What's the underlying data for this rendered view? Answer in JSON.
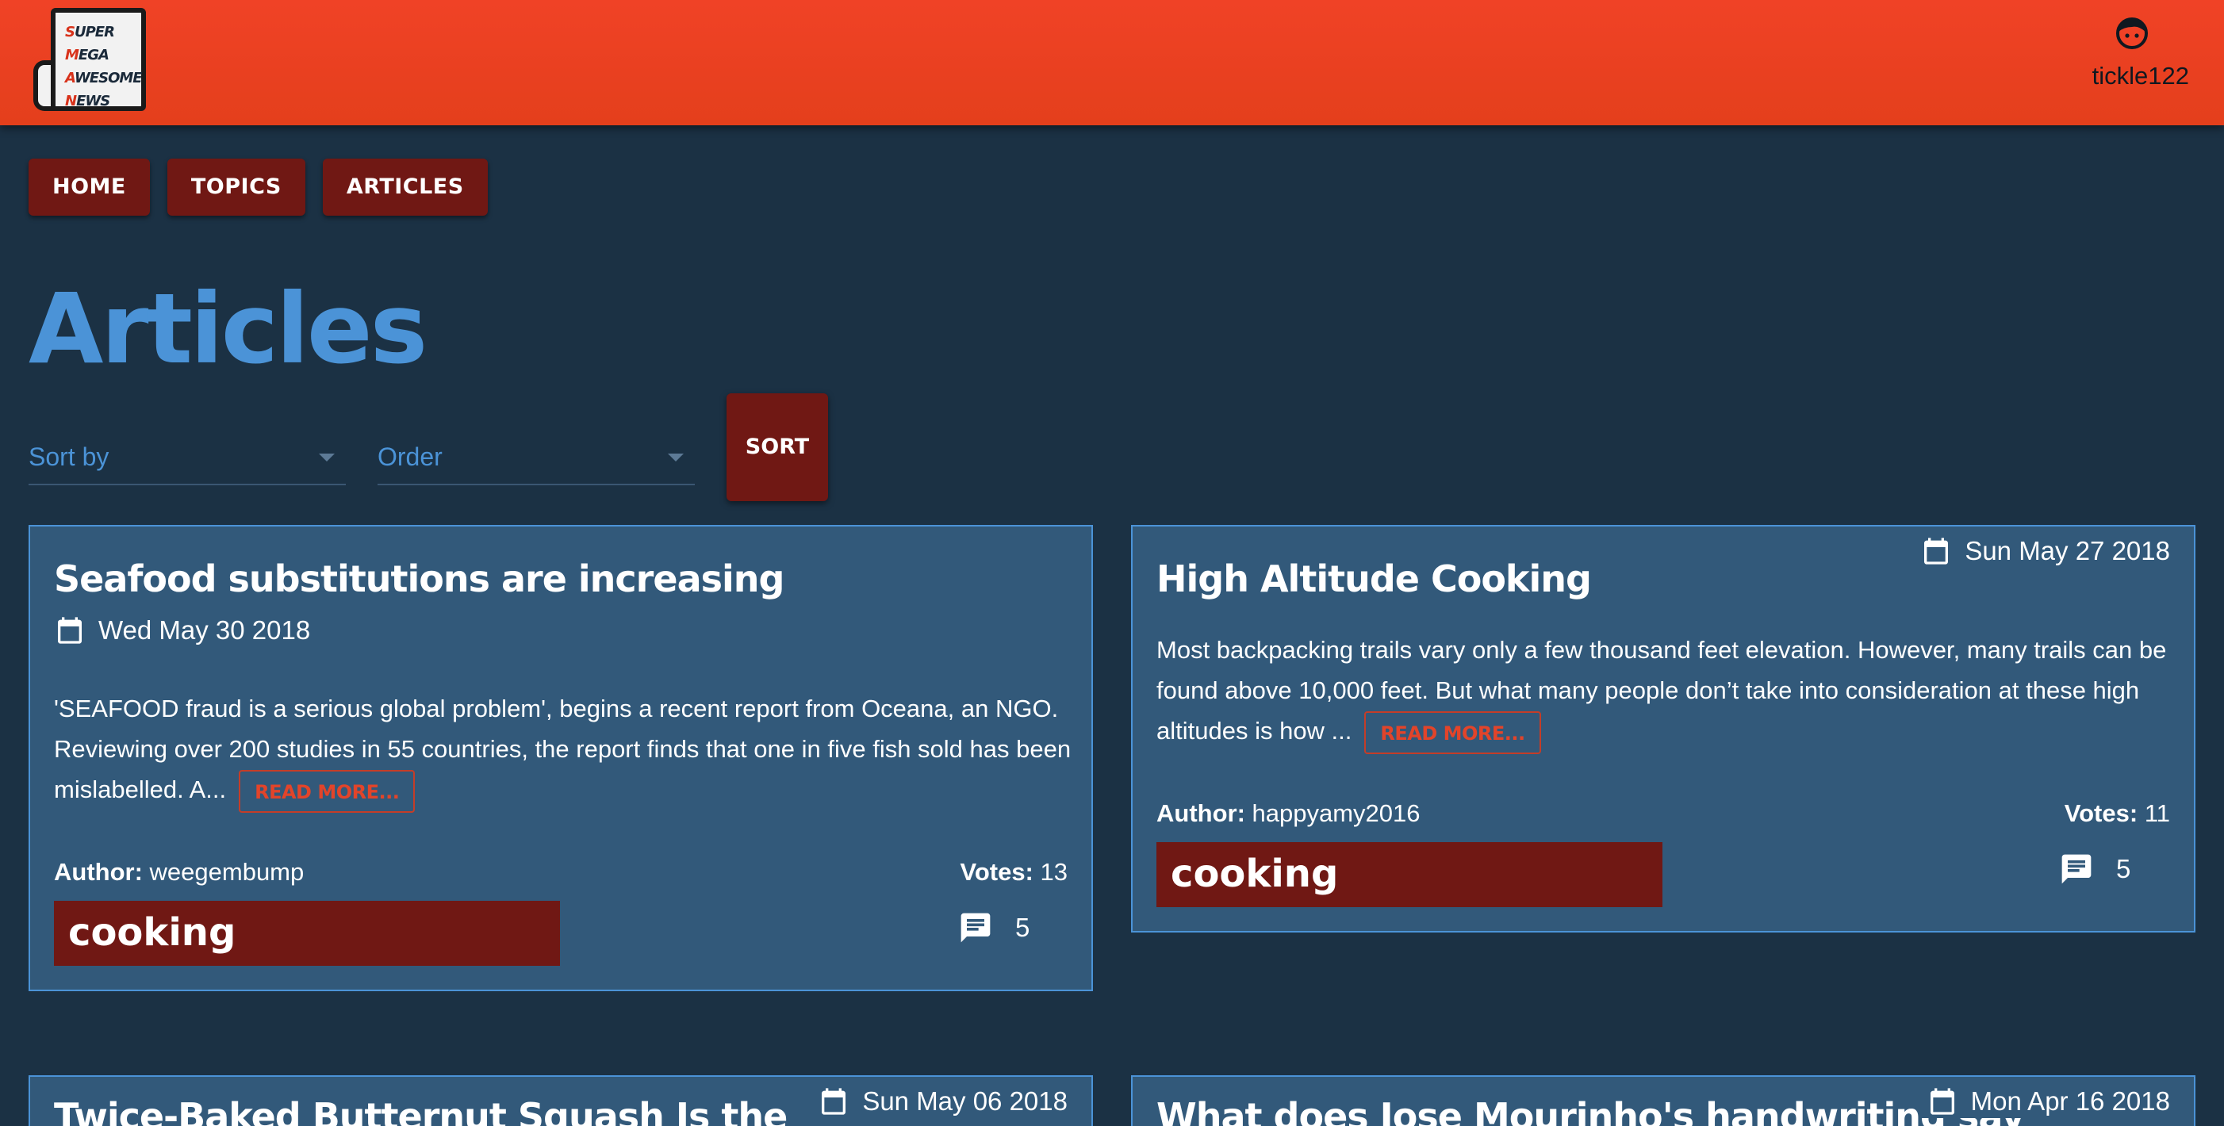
{
  "header": {
    "logo_lines": [
      "SUPER",
      "MEGA",
      "AWESOME",
      "NEWS"
    ],
    "username": "tickle122"
  },
  "nav": {
    "home": "HOME",
    "topics": "TOPICS",
    "articles": "ARTICLES"
  },
  "page_title": "Articles",
  "controls": {
    "sort_by_label": "Sort by",
    "order_label": "Order",
    "sort_button": "SORT"
  },
  "labels": {
    "author": "Author:",
    "votes": "Votes:",
    "read_more": "READ MORE..."
  },
  "articles": [
    {
      "title": "Seafood substitutions are increasing",
      "date": "Wed May 30 2018",
      "excerpt": "'SEAFOOD fraud is a serious global problem', begins a recent report from Oceana, an NGO. Reviewing over 200 studies in 55 countries, the report finds that one in five fish sold has been mislabelled. A...",
      "author": "weegembump",
      "votes": "13",
      "topic": "cooking",
      "comments": "5"
    },
    {
      "title": "High Altitude Cooking",
      "date": "Sun May 27 2018",
      "excerpt": "Most backpacking trails vary only a few thousand feet elevation. However, many trails can be found above 10,000 feet. But what many people don’t take into consideration at these high altitudes is how ...",
      "author": "happyamy2016",
      "votes": "11",
      "topic": "cooking",
      "comments": "5"
    },
    {
      "title": "Twice-Baked Butternut Squash Is the",
      "date": "Sun May 06 2018"
    },
    {
      "title": "What does Jose Mourinho's handwriting say",
      "date": "Mon Apr 16 2018"
    }
  ],
  "colors": {
    "background": "#1b3144",
    "header": "#f04226",
    "accent_blue": "#4b93d7",
    "card": "#32597a",
    "button_dark_red": "#701814",
    "read_more_red": "#e2442a"
  },
  "icons": [
    "user-face-icon",
    "calendar-icon",
    "comment-icon",
    "chevron-down-icon"
  ]
}
